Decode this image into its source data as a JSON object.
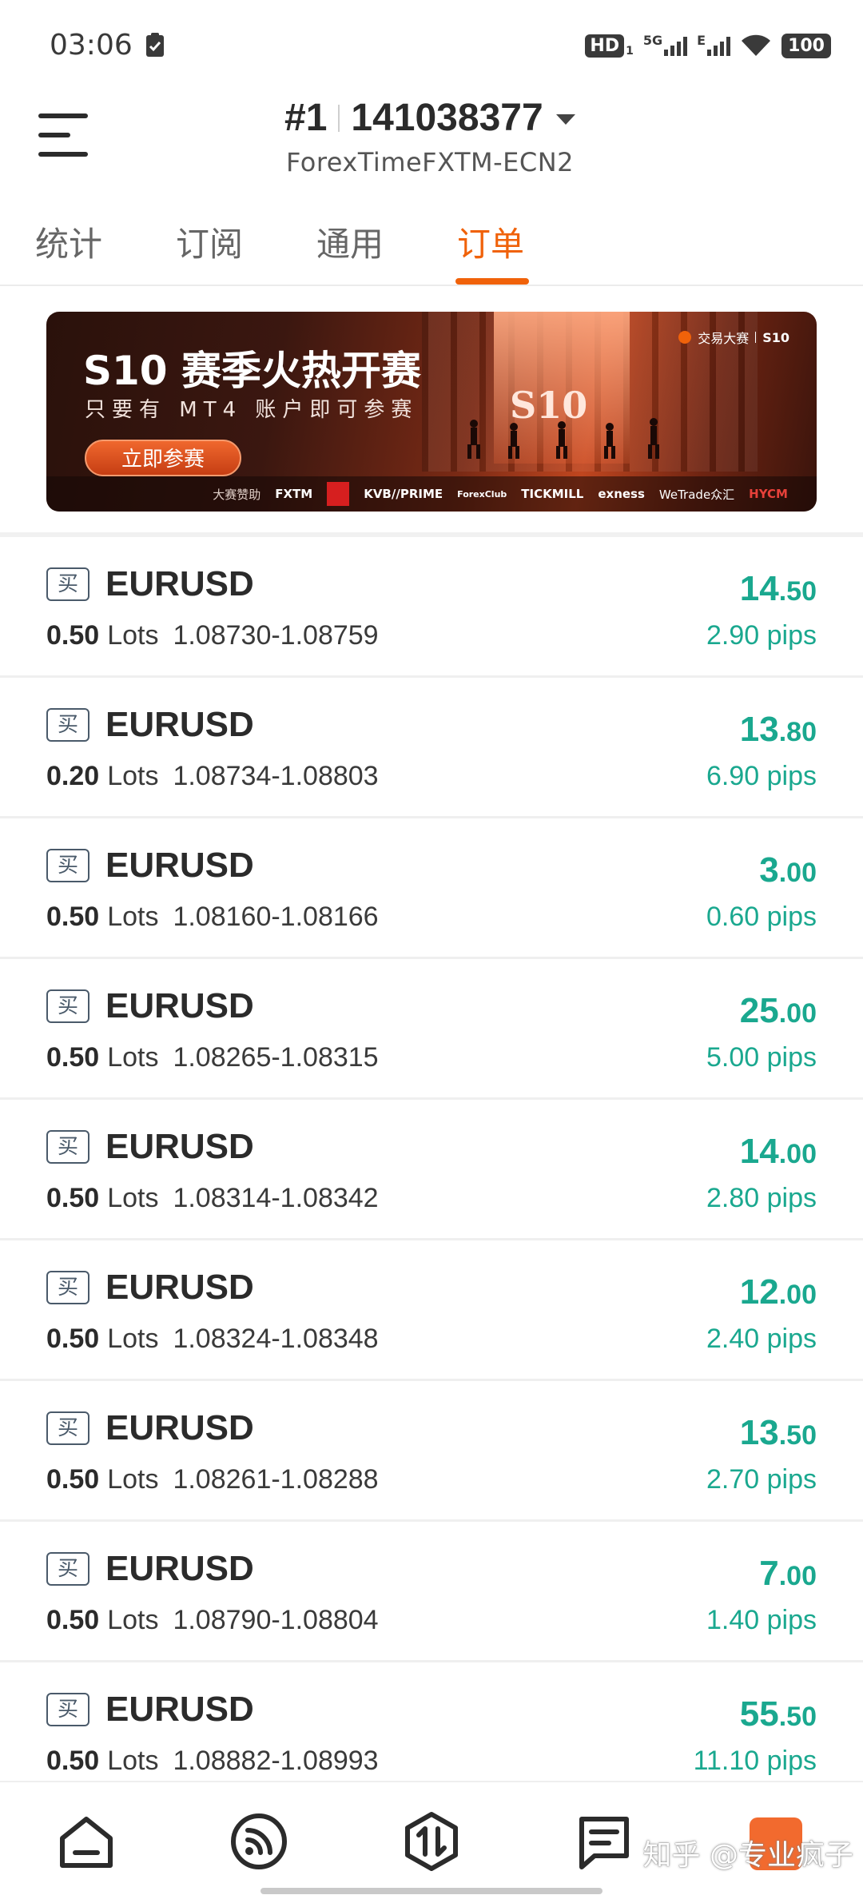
{
  "status_bar": {
    "time": "03:06",
    "hd": "HD",
    "hd_sub": "1",
    "net1": "5G",
    "net2": "E",
    "battery": "100"
  },
  "header": {
    "account_index": "#1",
    "account_number": "141038377",
    "server": "ForexTimeFXTM-ECN2"
  },
  "tabs": [
    {
      "label": "统计"
    },
    {
      "label": "订阅"
    },
    {
      "label": "通用"
    },
    {
      "label": "订单",
      "active": true
    }
  ],
  "banner": {
    "title": "S10 赛季火热开赛",
    "subtitle": "只要有 MT4 账户即可参赛",
    "button": "立即参赛",
    "big_mark": "S10",
    "brand": "交易大赛",
    "brand_season": "S10",
    "sponsor_label": "大赛赞助",
    "sponsors": [
      "FXTM",
      "KVB//PRIME",
      "ForexClub",
      "TICKMILL",
      "exness",
      "WeTrade众汇",
      "HYCM"
    ]
  },
  "orders": [
    {
      "side": "买",
      "symbol": "EURUSD",
      "lots": "0.50",
      "lots_unit": "Lots",
      "price_range": "1.08730-1.08759",
      "profit_int": "14",
      "profit_dec": ".50",
      "pips": "2.90 pips"
    },
    {
      "side": "买",
      "symbol": "EURUSD",
      "lots": "0.20",
      "lots_unit": "Lots",
      "price_range": "1.08734-1.08803",
      "profit_int": "13",
      "profit_dec": ".80",
      "pips": "6.90 pips"
    },
    {
      "side": "买",
      "symbol": "EURUSD",
      "lots": "0.50",
      "lots_unit": "Lots",
      "price_range": "1.08160-1.08166",
      "profit_int": "3",
      "profit_dec": ".00",
      "pips": "0.60 pips"
    },
    {
      "side": "买",
      "symbol": "EURUSD",
      "lots": "0.50",
      "lots_unit": "Lots",
      "price_range": "1.08265-1.08315",
      "profit_int": "25",
      "profit_dec": ".00",
      "pips": "5.00 pips"
    },
    {
      "side": "买",
      "symbol": "EURUSD",
      "lots": "0.50",
      "lots_unit": "Lots",
      "price_range": "1.08314-1.08342",
      "profit_int": "14",
      "profit_dec": ".00",
      "pips": "2.80 pips"
    },
    {
      "side": "买",
      "symbol": "EURUSD",
      "lots": "0.50",
      "lots_unit": "Lots",
      "price_range": "1.08324-1.08348",
      "profit_int": "12",
      "profit_dec": ".00",
      "pips": "2.40 pips"
    },
    {
      "side": "买",
      "symbol": "EURUSD",
      "lots": "0.50",
      "lots_unit": "Lots",
      "price_range": "1.08261-1.08288",
      "profit_int": "13",
      "profit_dec": ".50",
      "pips": "2.70 pips"
    },
    {
      "side": "买",
      "symbol": "EURUSD",
      "lots": "0.50",
      "lots_unit": "Lots",
      "price_range": "1.08790-1.08804",
      "profit_int": "7",
      "profit_dec": ".00",
      "pips": "1.40 pips"
    },
    {
      "side": "买",
      "symbol": "EURUSD",
      "lots": "0.50",
      "lots_unit": "Lots",
      "price_range": "1.08882-1.08993",
      "profit_int": "55",
      "profit_dec": ".50",
      "pips": "11.10 pips"
    }
  ],
  "bottom_nav": {
    "items": [
      "home-icon",
      "subscription-icon",
      "trade-icon",
      "message-icon",
      "orders-icon"
    ],
    "watermark": "知乎 @专业疯子"
  },
  "colors": {
    "accent": "#f0620a",
    "profit": "#1aa88f",
    "text": "#2b2b2b"
  }
}
